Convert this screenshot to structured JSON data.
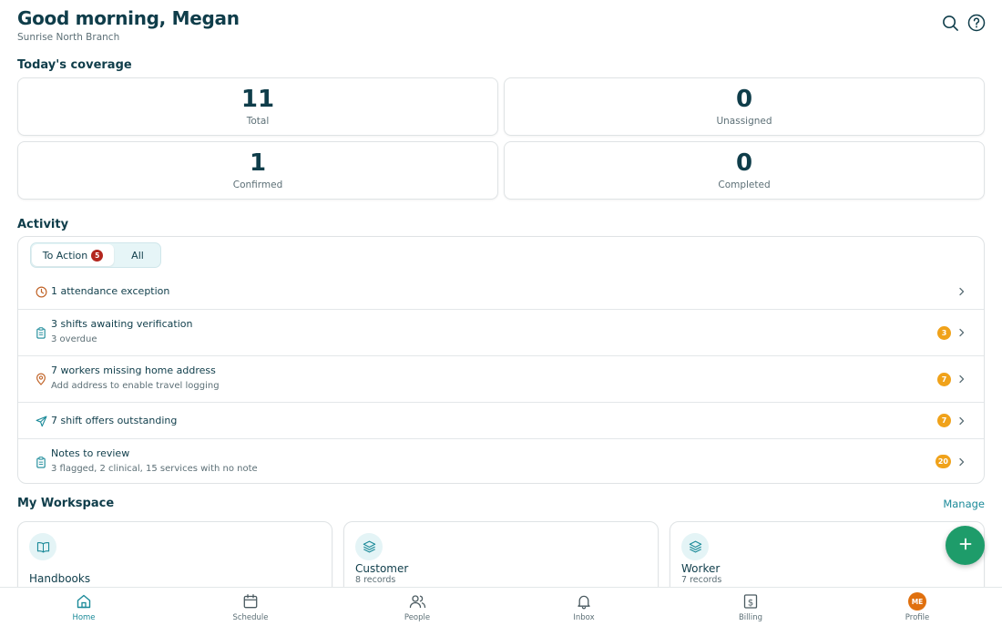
{
  "header": {
    "greeting": "Good morning, Megan",
    "branch": "Sunrise North Branch",
    "icons": [
      "search-icon",
      "help-icon"
    ]
  },
  "coverage": {
    "title": "Today's coverage",
    "stats": [
      {
        "value": "11",
        "label": "Total"
      },
      {
        "value": "0",
        "label": "Unassigned"
      },
      {
        "value": "1",
        "label": "Confirmed"
      },
      {
        "value": "0",
        "label": "Completed"
      }
    ]
  },
  "activity": {
    "title": "Activity",
    "tabs": [
      {
        "label": "To Action",
        "badge": "5",
        "active": true
      },
      {
        "label": "All",
        "active": false
      }
    ],
    "items": [
      {
        "icon": "clock-icon",
        "title": "1 attendance exception",
        "subtitle": "",
        "badge": ""
      },
      {
        "icon": "clipboard-icon",
        "title": "3 shifts awaiting verification",
        "subtitle": "3 overdue",
        "badge": "3"
      },
      {
        "icon": "location-pin-icon",
        "title": "7 workers missing home address",
        "subtitle": "Add address to enable travel logging",
        "badge": "7"
      },
      {
        "icon": "send-icon",
        "title": "7 shift offers outstanding",
        "subtitle": "",
        "badge": "7"
      },
      {
        "icon": "clipboard-icon",
        "title": "Notes to review",
        "subtitle": "3 flagged, 2 clinical, 15 services with no note",
        "badge": "20"
      }
    ],
    "colors": {
      "badge": "#f0a21a",
      "tab_badge": "#b3261e"
    }
  },
  "workspace": {
    "title": "My Workspace",
    "manage_label": "Manage",
    "cards": [
      {
        "icon": "book-icon",
        "title": "Handbooks",
        "subtitle": ""
      },
      {
        "icon": "layers-icon",
        "title": "Customer",
        "subtitle": "8 records"
      },
      {
        "icon": "layers-icon",
        "title": "Worker",
        "subtitle": "7 records"
      }
    ]
  },
  "fab": {
    "icon": "plus-icon",
    "color": "#1e9c6a"
  },
  "tabbar": {
    "items": [
      {
        "label": "Home",
        "icon": "home-icon",
        "active": true
      },
      {
        "label": "Schedule",
        "icon": "calendar-icon",
        "active": false
      },
      {
        "label": "People",
        "icon": "people-icon",
        "active": false
      },
      {
        "label": "Inbox",
        "icon": "bell-icon",
        "active": false
      },
      {
        "label": "Billing",
        "icon": "billing-icon",
        "active": false
      },
      {
        "label": "Profile",
        "icon": "avatar",
        "active": false,
        "initials": "ME"
      }
    ],
    "accent": "#1b8a99"
  }
}
